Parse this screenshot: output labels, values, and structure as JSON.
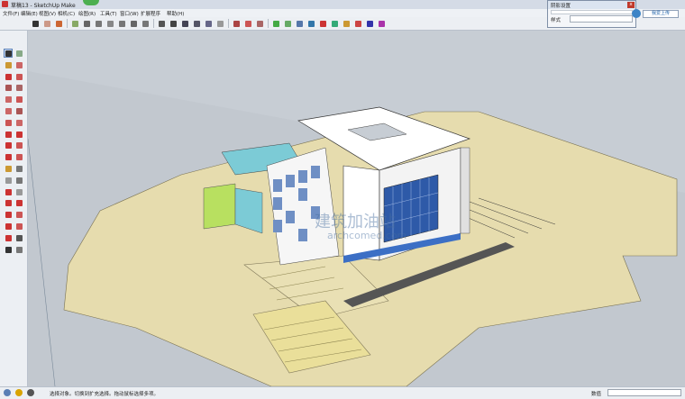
{
  "window": {
    "title": "草稿13 - SketchUp Make"
  },
  "menu": [
    "文件(F)",
    "编辑(E)",
    "视图(V)",
    "相机(C)",
    "绘图(R)",
    "工具(T)",
    "窗口(W)",
    "扩展程序",
    "帮助(H)"
  ],
  "toolbar_icons": [
    "select-icon",
    "eraser-icon",
    "paint-icon",
    "standard-views-icon",
    "iso-icon",
    "top-view-icon",
    "front-view-icon",
    "right-view-icon",
    "back-view-icon",
    "left-view-icon",
    "xray-icon",
    "wireframe-icon",
    "hidden-line-icon",
    "shaded-icon",
    "shaded-texture-icon",
    "monochrome-icon",
    "section-plane-icon",
    "section-display-icon",
    "section-cut-icon",
    "add-location-icon",
    "toggle-terrain-icon",
    "photo-texture-icon",
    "preview-3d-icon",
    "get-models-icon",
    "share-model-icon",
    "warehouse-icon",
    "extension-icon",
    "layout-icon",
    "style-builder-icon"
  ],
  "left_tools": [
    "select-icon",
    "component-icon",
    "paint-icon",
    "eraser-icon",
    "line-icon",
    "freehand-icon",
    "rectangle-icon",
    "rotated-rect-icon",
    "circle-icon",
    "polygon-icon",
    "arc-icon",
    "pie-icon",
    "arc-2pt-icon",
    "arc-3pt-icon",
    "move-icon",
    "pushpull-icon",
    "rotate-icon",
    "followme-icon",
    "scale-icon",
    "offset-icon",
    "tape-icon",
    "dimension-icon",
    "protractor-icon",
    "text-icon",
    "axes-icon",
    "3dtext-icon",
    "orbit-icon",
    "pan-icon",
    "zoom-icon",
    "zoom-window-icon",
    "zoom-extents-icon",
    "prev-view-icon",
    "position-camera-icon",
    "lookaround-icon",
    "walk-icon",
    "section-icon"
  ],
  "panel": {
    "title": "阴影设置",
    "close": "x",
    "row_label": "样式",
    "side_button": "我爱上传"
  },
  "status": {
    "hint": "选择对象。切换到扩充选择。拖动鼠标选择多项。",
    "value_label": "数值",
    "value": ""
  },
  "watermark": {
    "line1": "建筑加油站",
    "line2": "archcomed.com"
  },
  "colors": {
    "ground": "#c6ccd3",
    "pad": "#e6dcae",
    "building": "#ffffff",
    "glass": "#6f8fc4",
    "green": "#b8e060",
    "teal": "#7ccbd6"
  }
}
